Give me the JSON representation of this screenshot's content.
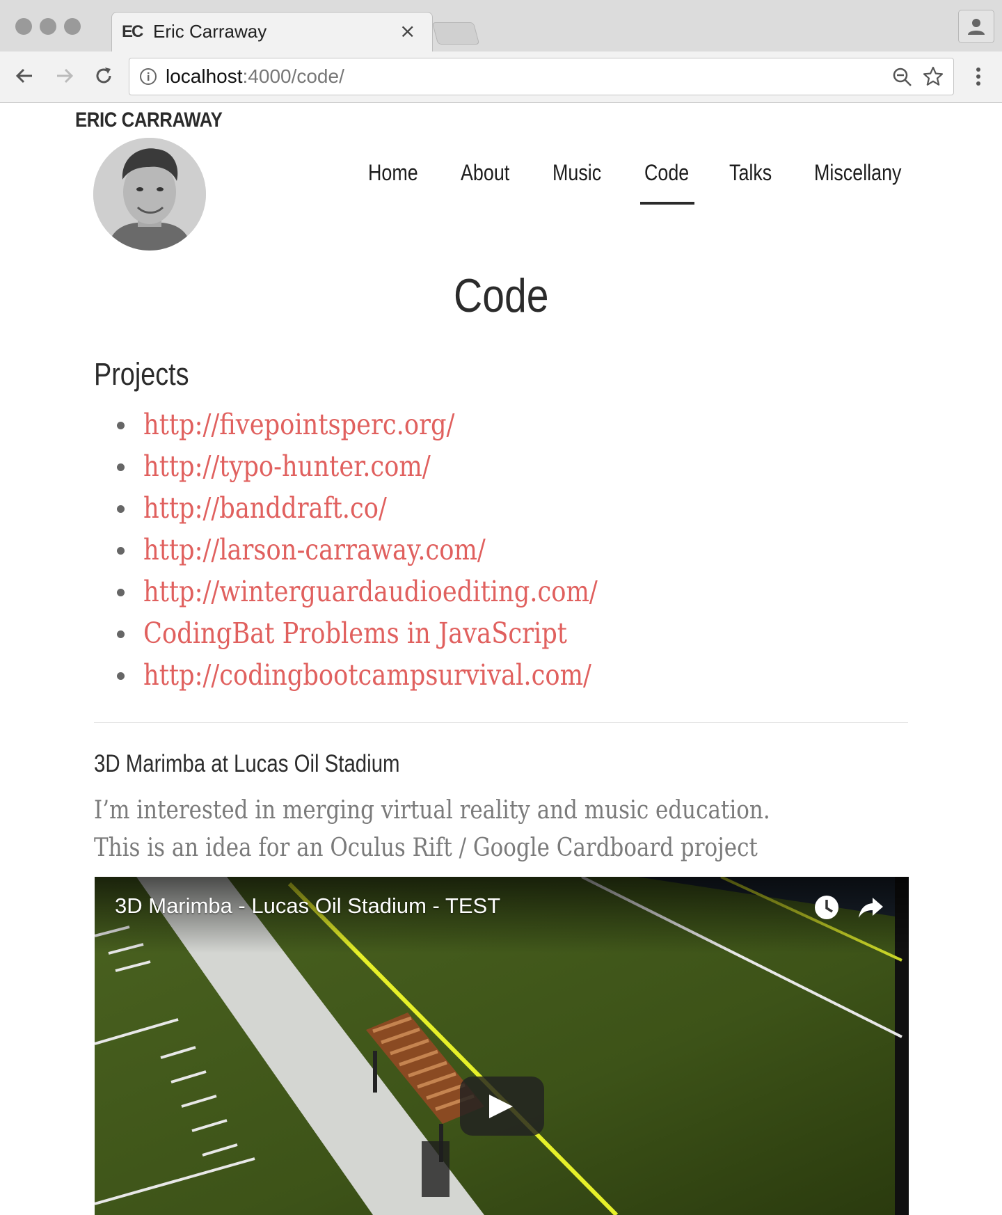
{
  "browser": {
    "tab_favicon": "EC",
    "tab_title": "Eric Carraway",
    "tab_close": "×",
    "url_host": "localhost",
    "url_rest": ":4000/code/"
  },
  "site": {
    "brand": "ERIC CARRAWAY",
    "nav": [
      "Home",
      "About",
      "Music",
      "Code",
      "Talks",
      "Miscellany"
    ],
    "active_nav": "Code"
  },
  "page": {
    "title": "Code",
    "section_heading": "Projects",
    "projects": [
      "http://fivepointsperc.org/",
      "http://typo-hunter.com/",
      "http://banddraft.co/",
      "http://larson-carraway.com/",
      "http://winterguardaudioediting.com/",
      "CodingBat Problems in JavaScript",
      "http://codingbootcampsurvival.com/"
    ],
    "post": {
      "title": "3D Marimba at Lucas Oil Stadium",
      "body": "I’m interested in merging virtual reality and music education. This is an idea for an Oculus Rift / Google Cardboard project",
      "video_title": "3D Marimba - Lucas Oil Stadium - TEST"
    }
  },
  "colors": {
    "link": "#e0605e",
    "body_text": "#7a7a7a",
    "heading": "#2b2b2b",
    "field": "#3f5218",
    "field_line": "#e6f02a"
  }
}
